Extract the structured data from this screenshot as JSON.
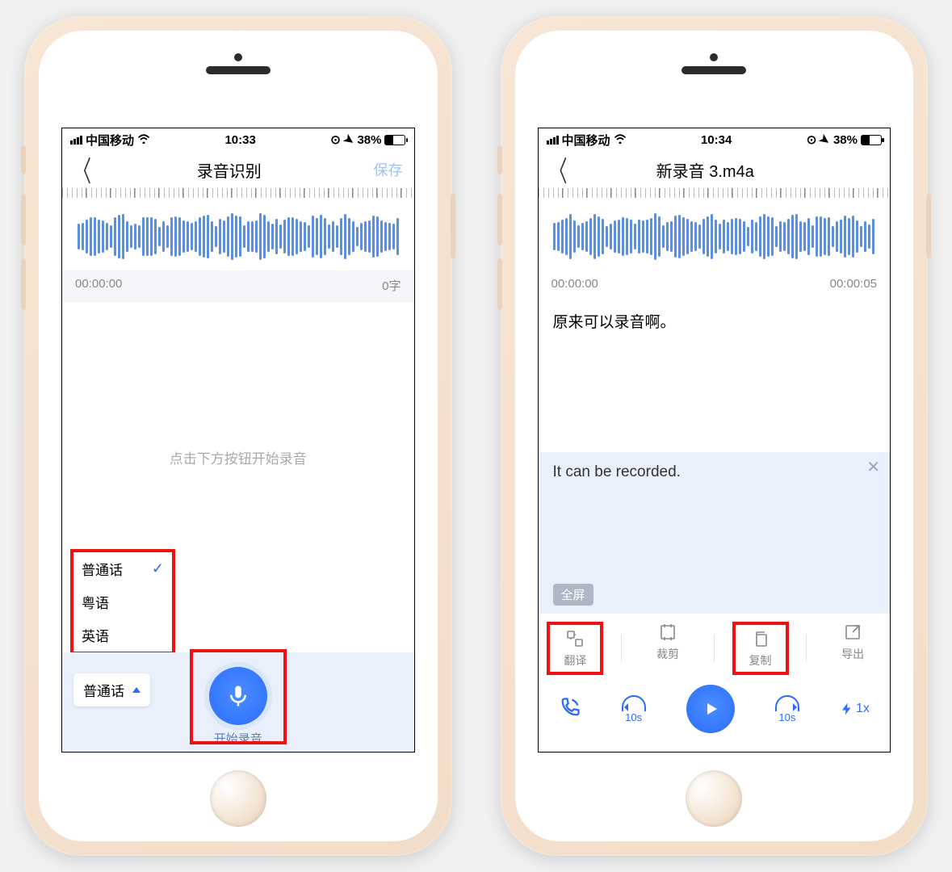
{
  "left": {
    "status": {
      "carrier": "中国移动",
      "time": "10:33",
      "battery": "38%"
    },
    "nav": {
      "title": "录音识别",
      "save": "保存"
    },
    "timerow": {
      "left": "00:00:00",
      "right": "0字"
    },
    "hint": "点击下方按钮开始录音",
    "langs": {
      "items": [
        "普通话",
        "粤语",
        "英语"
      ],
      "selected": "普通话"
    },
    "recordLabel": "开始录音"
  },
  "right": {
    "status": {
      "carrier": "中国移动",
      "time": "10:34",
      "battery": "38%"
    },
    "nav": {
      "title": "新录音 3.m4a"
    },
    "timerow": {
      "left": "00:00:00",
      "right": "00:00:05"
    },
    "transcript": "原来可以录音啊。",
    "translation": "It can be recorded.",
    "fullscreen": "全屏",
    "tools": {
      "translate": "翻译",
      "trim": "裁剪",
      "copy": "复制",
      "export": "导出"
    },
    "jump": "10s",
    "speed": "1x"
  }
}
